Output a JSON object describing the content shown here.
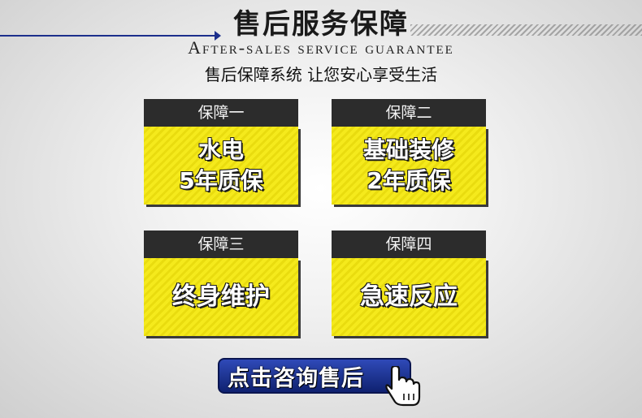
{
  "header": {
    "title": "售后服务保障",
    "subtitle": "After-sales service guarantee",
    "tagline": "售后保障系统 让您安心享受生活"
  },
  "cards": [
    {
      "head": "保障一",
      "lines": [
        "水电",
        "5年质保"
      ]
    },
    {
      "head": "保障二",
      "lines": [
        "基础装修",
        "2年质保"
      ]
    },
    {
      "head": "保障三",
      "lines": [
        "终身维护"
      ]
    },
    {
      "head": "保障四",
      "lines": [
        "急速反应"
      ]
    }
  ],
  "cta": {
    "label": "点击咨询售后",
    "icon": "hand-pointer-icon"
  },
  "colors": {
    "accent_yellow": "#f5ea1c",
    "card_head": "#2c2c2c",
    "button_blue": "#1c2f8c"
  }
}
